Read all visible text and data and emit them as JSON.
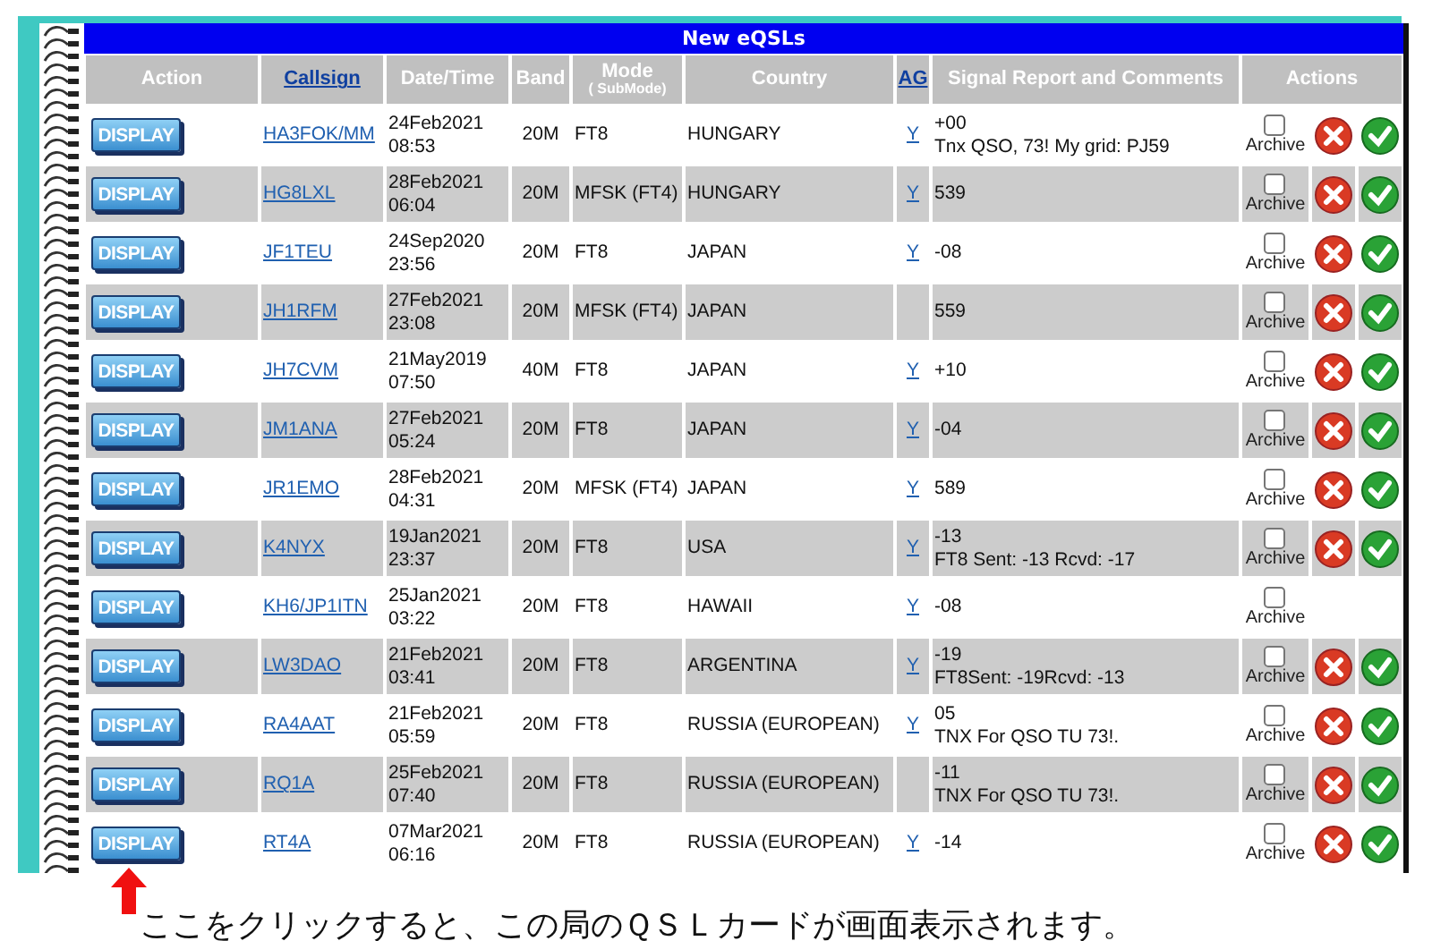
{
  "table": {
    "title": "New eQSLs",
    "columns": [
      {
        "label": "Action",
        "link": false
      },
      {
        "label": "Callsign",
        "link": true
      },
      {
        "label": "Date/Time",
        "link": false
      },
      {
        "label": "Band",
        "link": false
      },
      {
        "label": "Mode",
        "sub": "( SubMode)",
        "link": false
      },
      {
        "label": "Country",
        "link": false
      },
      {
        "label": "AG",
        "link": true
      },
      {
        "label": "Signal Report and Comments",
        "link": false
      },
      {
        "label": "Actions",
        "link": false
      }
    ],
    "rows": [
      {
        "action": "DISPLAY",
        "callsign": "HA3FOK/MM",
        "date": "24Feb2021",
        "time": "08:53",
        "band": "20M",
        "mode": "FT8",
        "country": "HUNGARY",
        "ag": "Y",
        "report": "+00",
        "comment": "Tnx QSO, 73! My grid: PJ59",
        "archive_label": "Archive",
        "archived": false,
        "reject": true,
        "accept": true
      },
      {
        "action": "DISPLAY",
        "callsign": "HG8LXL",
        "date": "28Feb2021",
        "time": "06:04",
        "band": "20M",
        "mode": "MFSK (FT4)",
        "country": "HUNGARY",
        "ag": "Y",
        "report": "539",
        "archive_label": "Archive",
        "archived": false,
        "reject": true,
        "accept": true
      },
      {
        "action": "DISPLAY",
        "callsign": "JF1TEU",
        "date": "24Sep2020",
        "time": "23:56",
        "band": "20M",
        "mode": "FT8",
        "country": "JAPAN",
        "ag": "Y",
        "report": "-08",
        "archive_label": "Archive",
        "archived": false,
        "reject": true,
        "accept": true
      },
      {
        "action": "DISPLAY",
        "callsign": "JH1RFM",
        "date": "27Feb2021",
        "time": "23:08",
        "band": "20M",
        "mode": "MFSK (FT4)",
        "country": "JAPAN",
        "report": "559",
        "archive_label": "Archive",
        "archived": false,
        "reject": true,
        "accept": true
      },
      {
        "action": "DISPLAY",
        "callsign": "JH7CVM",
        "date": "21May2019",
        "time": "07:50",
        "band": "40M",
        "mode": "FT8",
        "country": "JAPAN",
        "ag": "Y",
        "report": "+10",
        "archive_label": "Archive",
        "archived": false,
        "reject": true,
        "accept": true
      },
      {
        "action": "DISPLAY",
        "callsign": "JM1ANA",
        "date": "27Feb2021",
        "time": "05:24",
        "band": "20M",
        "mode": "FT8",
        "country": "JAPAN",
        "ag": "Y",
        "report": "-04",
        "archive_label": "Archive",
        "archived": false,
        "reject": true,
        "accept": true
      },
      {
        "action": "DISPLAY",
        "callsign": "JR1EMO",
        "date": "28Feb2021",
        "time": "04:31",
        "band": "20M",
        "mode": "MFSK (FT4)",
        "country": "JAPAN",
        "ag": "Y",
        "report": "589",
        "archive_label": "Archive",
        "archived": false,
        "reject": true,
        "accept": true
      },
      {
        "action": "DISPLAY",
        "callsign": "K4NYX",
        "date": "19Jan2021",
        "time": "23:37",
        "band": "20M",
        "mode": "FT8",
        "country": "USA",
        "ag": "Y",
        "report": "-13",
        "comment": "FT8 Sent: -13 Rcvd: -17",
        "archive_label": "Archive",
        "archived": false,
        "reject": true,
        "accept": true
      },
      {
        "action": "DISPLAY",
        "callsign": "KH6/JP1ITN",
        "date": "25Jan2021",
        "time": "03:22",
        "band": "20M",
        "mode": "FT8",
        "country": "HAWAII",
        "ag": "Y",
        "report": "-08",
        "archive_label": "Archive",
        "archived": false,
        "reject": false,
        "accept": false
      },
      {
        "action": "DISPLAY",
        "callsign": "LW3DAO",
        "date": "21Feb2021",
        "time": "03:41",
        "band": "20M",
        "mode": "FT8",
        "country": "ARGENTINA",
        "ag": "Y",
        "report": "-19",
        "comment": "FT8Sent: -19Rcvd: -13",
        "archive_label": "Archive",
        "archived": false,
        "reject": true,
        "accept": true
      },
      {
        "action": "DISPLAY",
        "callsign": "RA4AAT",
        "date": "21Feb2021",
        "time": "05:59",
        "band": "20M",
        "mode": "FT8",
        "country": "RUSSIA (EUROPEAN)",
        "ag": "Y",
        "report": "05",
        "comment": "TNX For QSO TU 73!.",
        "archive_label": "Archive",
        "archived": false,
        "reject": true,
        "accept": true
      },
      {
        "action": "DISPLAY",
        "callsign": "RQ1A",
        "date": "25Feb2021",
        "time": "07:40",
        "band": "20M",
        "mode": "FT8",
        "country": "RUSSIA (EUROPEAN)",
        "report": "-11",
        "comment": "TNX For QSO TU 73!.",
        "archive_label": "Archive",
        "archived": false,
        "reject": true,
        "accept": true
      },
      {
        "action": "DISPLAY",
        "callsign": "RT4A",
        "date": "07Mar2021",
        "time": "06:16",
        "band": "20M",
        "mode": "FT8",
        "country": "RUSSIA (EUROPEAN)",
        "ag": "Y",
        "report": "-14",
        "archive_label": "Archive",
        "archived": false,
        "reject": true,
        "accept": true
      }
    ]
  },
  "caption": "ここをクリックすると、この局のＱＳＬカードが画面表示されます。"
}
